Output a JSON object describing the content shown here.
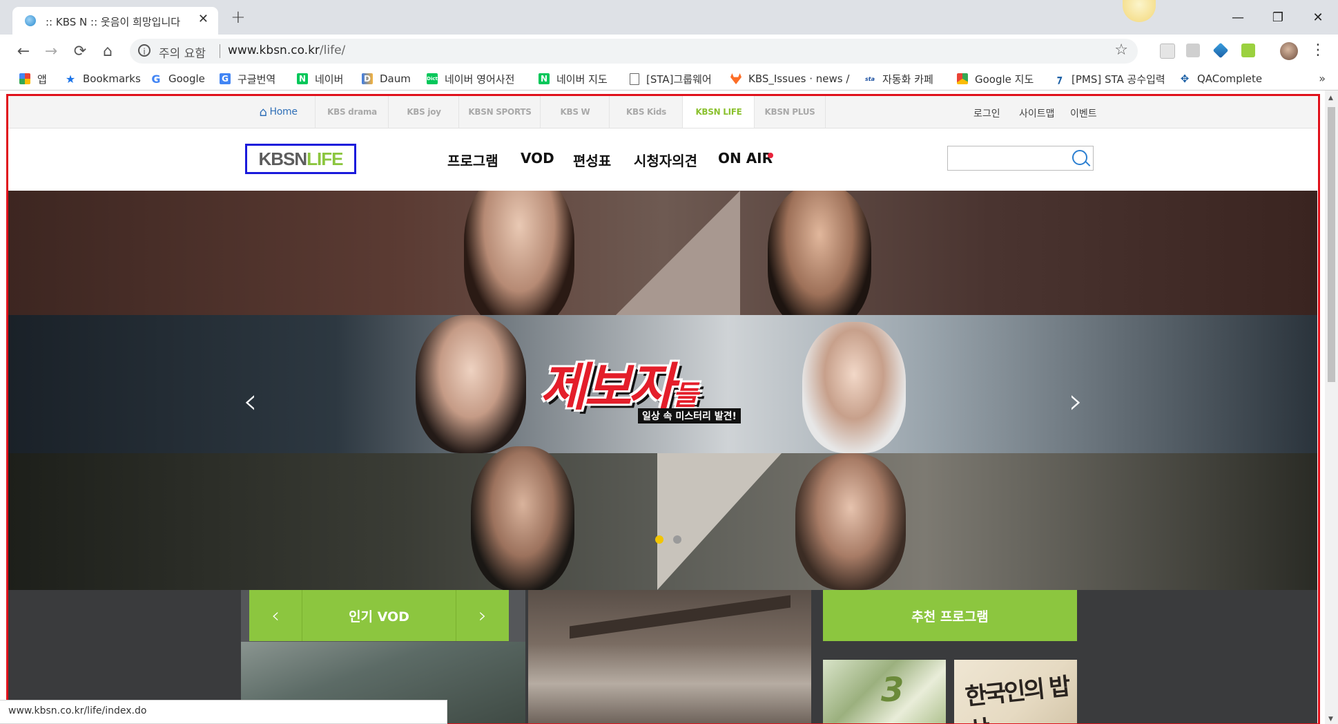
{
  "browser": {
    "tab": {
      "title": ":: KBS N :: 웃음이 희망입니다",
      "close": "✕"
    },
    "new_tab": "+",
    "window_controls": {
      "minimize": "—",
      "restore": "❐",
      "close": "✕"
    },
    "toolbar": {
      "back": "←",
      "forward": "→",
      "reload": "⟳",
      "home": "⌂",
      "info_icon": "i",
      "security_text": "주의 요함",
      "url_host": "www.kbsn.co.kr",
      "url_path": "/life/",
      "star": "☆",
      "menu": "⋮"
    },
    "bookmarks": [
      {
        "label": "앱",
        "icon": "apps-icon"
      },
      {
        "label": "Bookmarks",
        "icon": "star-icon"
      },
      {
        "label": "Google",
        "icon": "google-icon"
      },
      {
        "label": "구글번역",
        "icon": "translate-icon"
      },
      {
        "label": "네이버",
        "icon": "naver-icon"
      },
      {
        "label": "Daum",
        "icon": "daum-icon"
      },
      {
        "label": "네이버 영어사전",
        "icon": "dict-icon"
      },
      {
        "label": "네이버 지도",
        "icon": "naver-icon"
      },
      {
        "label": "[STA]그룹웨어",
        "icon": "page-icon"
      },
      {
        "label": "KBS_Issues · news /",
        "icon": "gitlab-icon"
      },
      {
        "label": "자동화 카페",
        "icon": "sta-icon"
      },
      {
        "label": "Google 지도",
        "icon": "maps-icon"
      },
      {
        "label": "[PMS] STA 공수입력",
        "icon": "pms-icon"
      },
      {
        "label": "QAComplete",
        "icon": "qa-icon"
      }
    ],
    "bookmarks_more": "»",
    "status_url": "www.kbsn.co.kr/life/index.do"
  },
  "site": {
    "channels": [
      {
        "label": "Home",
        "icon": "home-icon"
      },
      {
        "label": "KBS drama"
      },
      {
        "label": "KBS joy"
      },
      {
        "label": "KBSN SPORTS"
      },
      {
        "label": "KBS W"
      },
      {
        "label": "KBS Kids"
      },
      {
        "label": "KBSN LIFE"
      },
      {
        "label": "KBSN PLUS"
      }
    ],
    "utility": [
      "로그인",
      "사이트맵",
      "이벤트"
    ],
    "logo": {
      "part1": "KBSN",
      "part2": "LIFE"
    },
    "gnb": [
      "프로그램",
      "VOD",
      "편성표",
      "시청자의견",
      "ON AIR"
    ],
    "search": {
      "value": "",
      "placeholder": ""
    },
    "hero": {
      "title_main": "제보자",
      "title_small": "들",
      "subtitle": "일상 속 미스터리 발견!",
      "prev": "‹",
      "next": "›",
      "dots": 2,
      "active_dot": 0
    },
    "popular_vod": {
      "label": "인기 VOD",
      "prev": "‹",
      "next": "›"
    },
    "recommended": {
      "label": "추천 프로그램",
      "items": [
        {
          "badge": "3"
        },
        {
          "title": "한국인의 밥상"
        }
      ]
    }
  },
  "colors": {
    "accent_green": "#8cc63f",
    "frame_red": "#e0111b",
    "logo_border": "#1a1adb",
    "onair_dot": "#e8223a",
    "dot_active": "#f2c500",
    "dot_inactive": "#9a9a9a"
  }
}
